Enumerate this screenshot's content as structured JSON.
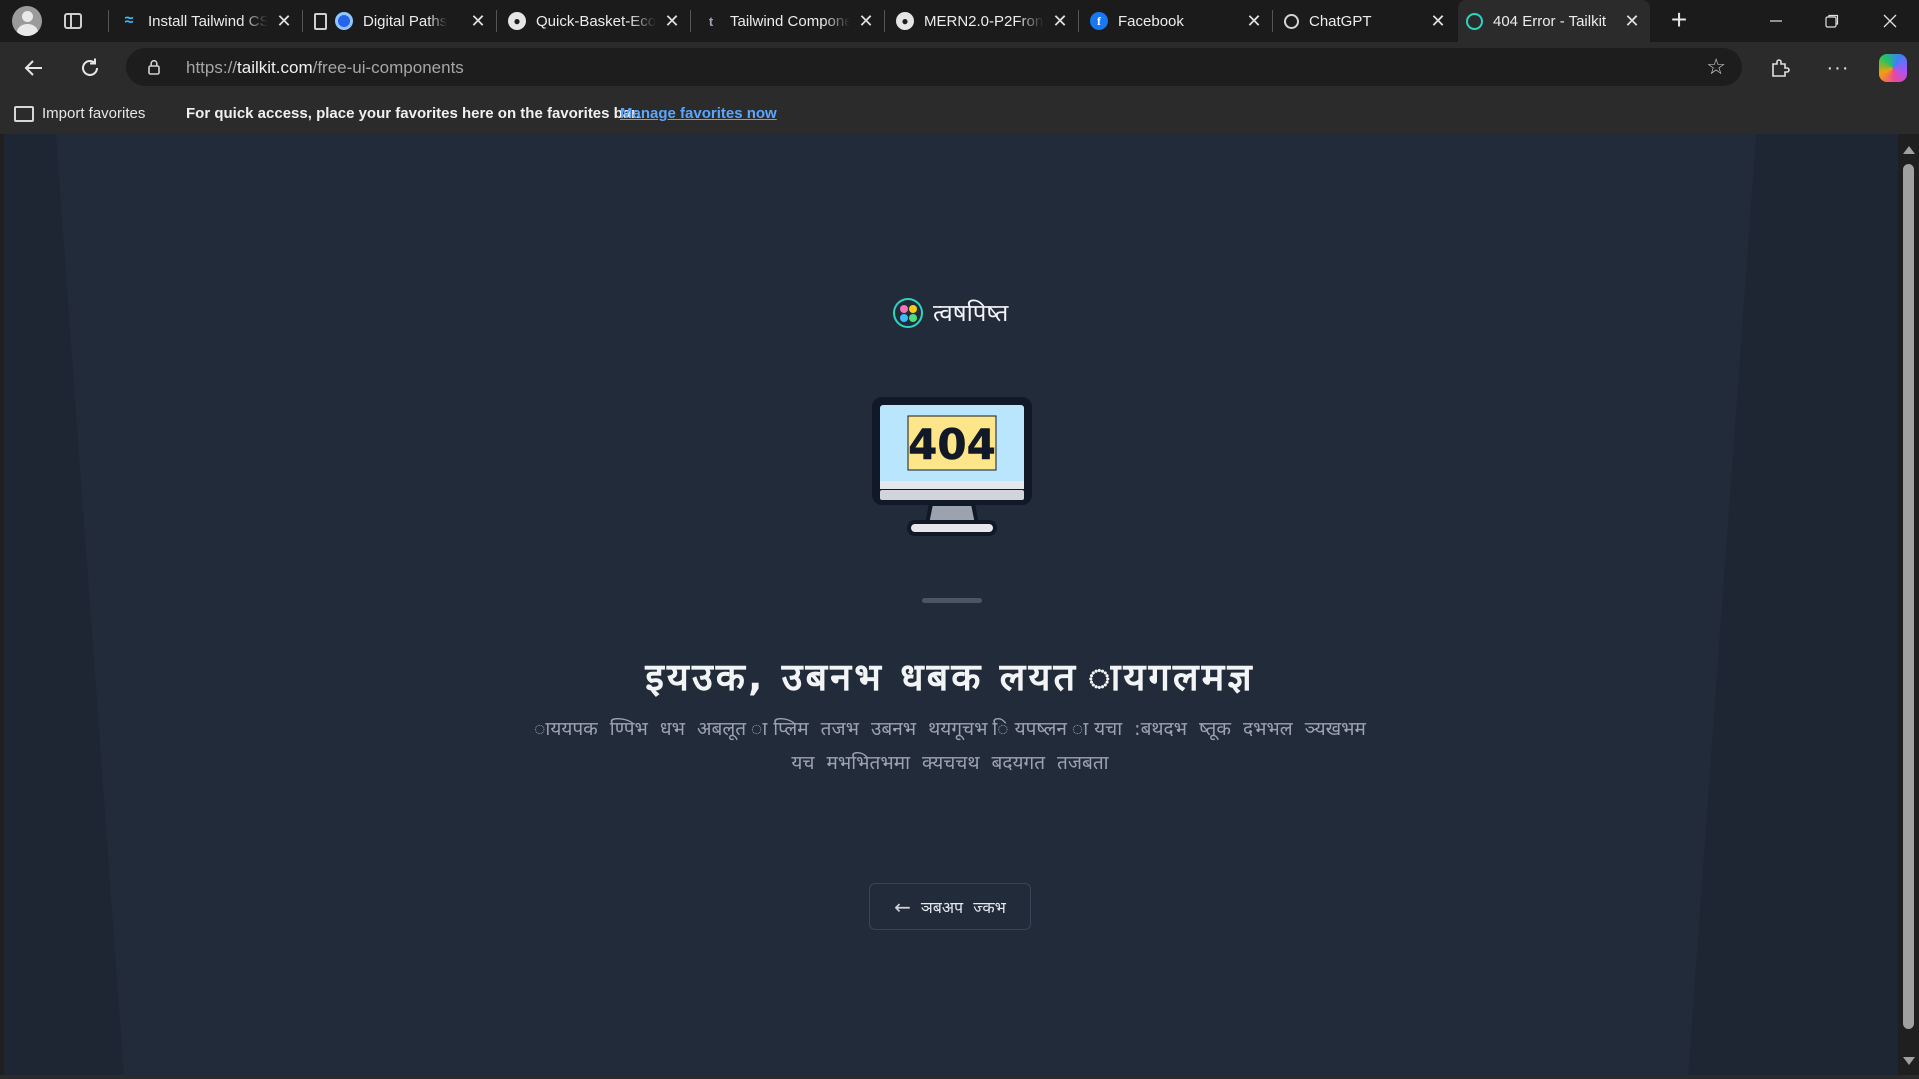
{
  "browser": {
    "tabs": [
      {
        "title": "Install Tailwind CSS",
        "icon": "tailwind-icon",
        "active": false
      },
      {
        "title": "Digital Paths",
        "icon": "digital-paths-icon",
        "active": false
      },
      {
        "title": "Quick-Basket-Ecommerce",
        "icon": "github-icon",
        "active": false
      },
      {
        "title": "Tailwind Components",
        "icon": "tailkit-icon",
        "active": false
      },
      {
        "title": "MERN2.0-P2Frontend",
        "icon": "github-icon",
        "active": false
      },
      {
        "title": "Facebook",
        "icon": "facebook-icon",
        "active": false
      },
      {
        "title": "ChatGPT",
        "icon": "chatgpt-icon",
        "active": false
      },
      {
        "title": "404 Error - Tailkit",
        "icon": "tailkit-icon",
        "active": true
      }
    ],
    "close_glyph": "✕",
    "new_tab_glyph": "+",
    "address": {
      "prefix": "https://",
      "domain": "tailkit.com",
      "path": "/free-ui-components"
    },
    "favorites_bar": {
      "import_label": "Import favorites",
      "message": "For quick access, place your favorites here on the favorites bar.",
      "manage_link": "Manage favorites now"
    }
  },
  "page": {
    "brand_name": "त्वषपिष्त",
    "monitor_text": "404",
    "headline": "इयउक, उबनभ धबक लयत ायगलमज्ञ",
    "subtext_line1": "ाययपक ण्पिभ धभ अबलूत ाप्लिम तजभ उबनभ थयगूचभ ियपष्लन ायचा :बथदभ ष्तूक दभभल ञ्यखभम",
    "subtext_line2": "यच मभभितभमा क्यचचथ बदयगत तजबता",
    "back_button_label": "ञबअप ज्कभ"
  },
  "colors": {
    "page_bg": "#1e2633",
    "panel_bg": "#222b3a",
    "accent_teal": "#2dd4bf",
    "link_blue": "#5aa7ff",
    "screen_yellow": "#fde68a",
    "screen_blue": "#bae6fd"
  }
}
